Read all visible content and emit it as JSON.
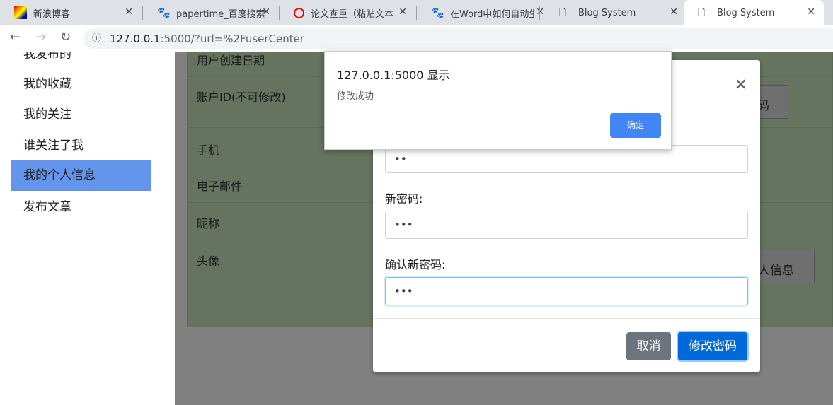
{
  "browser": {
    "tabs": [
      {
        "title": "新浪博客",
        "icon": "sina-blog-icon"
      },
      {
        "title": "papertime_百度搜索",
        "icon": "baidu-paw-icon"
      },
      {
        "title": "论文查重（粘贴文本",
        "icon": "checker-icon"
      },
      {
        "title": "在Word中如何自动生",
        "icon": "baidu-paw-icon"
      },
      {
        "title": "Blog System",
        "icon": "page-icon"
      },
      {
        "title": "Blog System",
        "icon": "page-icon"
      }
    ],
    "url_host": "127.0.0.1",
    "url_rest": ":5000/?url=%2FuserCenter"
  },
  "sidebar": {
    "items": [
      "我发布的",
      "我的收藏",
      "我的关注",
      "谁关注了我",
      "我的个人信息",
      "发布文章"
    ],
    "active": 4
  },
  "info": {
    "rows": [
      "用户创建日期",
      "账户ID(不可修改)",
      "手机",
      "电子邮件",
      "昵称",
      "头像"
    ],
    "btn_pw": "码",
    "btn_info": "人信息"
  },
  "modal": {
    "old_value": "••",
    "new_label": "新密码:",
    "new_value": "•••",
    "confirm_label": "确认新密码:",
    "confirm_value": "•••",
    "cancel": "取消",
    "submit": "修改密码",
    "close": "×"
  },
  "alert": {
    "title": "127.0.0.1:5000 显示",
    "message": "修改成功",
    "ok": "确定"
  },
  "colors": {
    "active": "#6495ed",
    "primary": "#0069d9",
    "secondary": "#6c757d",
    "alert_ok": "#4285f4"
  }
}
